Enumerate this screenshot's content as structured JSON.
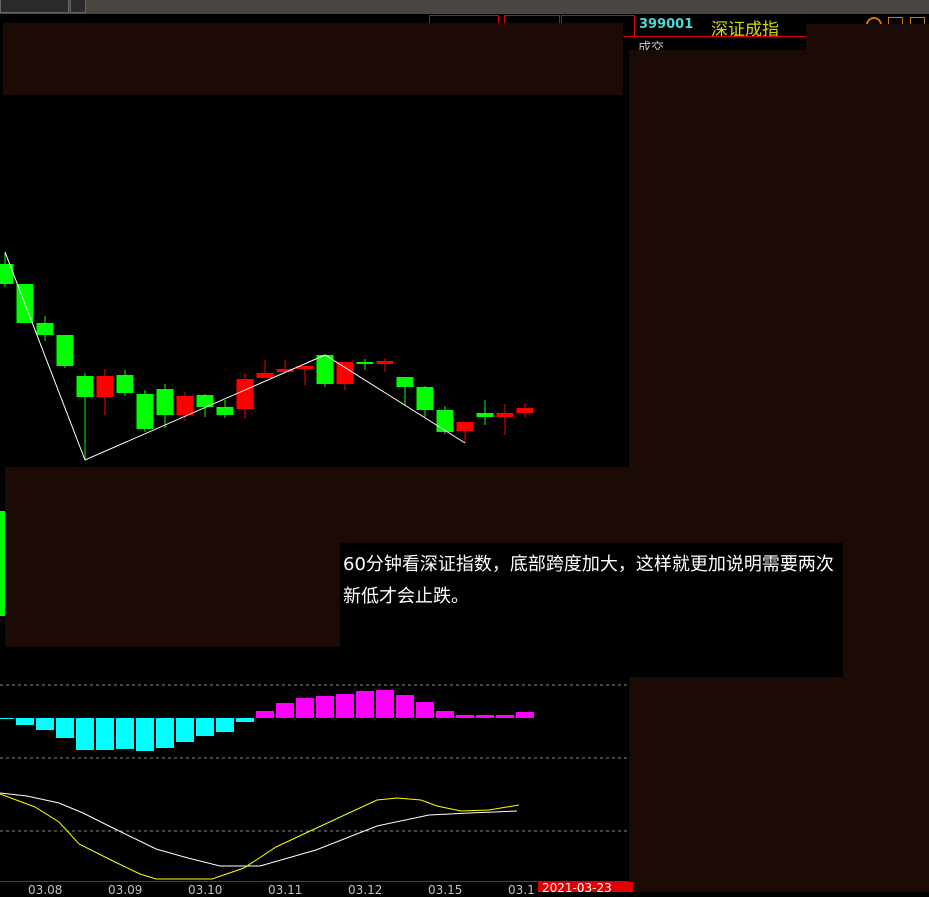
{
  "header": {
    "code": "399001",
    "name": "深证成指",
    "sub_label": "成交"
  },
  "axis": {
    "dates": [
      "03.08",
      "03.09",
      "03.10",
      "03.11",
      "03.12",
      "03.15",
      "03.1"
    ],
    "cursor_date": "2021-03-23"
  },
  "annotation": {
    "text": "60分钟看深证指数，底部跨度加大，这样就更加说明需要两次新低才会止跌。"
  },
  "colors": {
    "up": "#ff0000",
    "down": "#00ff00",
    "macd_pos": "#ff00ff",
    "macd_neg": "#00ffff",
    "dif": "#ffffff",
    "dea": "#ffff00",
    "overlay": "#1c0a06"
  },
  "chart_data": {
    "type": "candlestick",
    "candles": [
      {
        "o": 264,
        "c": 284,
        "h": 252,
        "l": 287
      },
      {
        "o": 284,
        "c": 323,
        "h": 284,
        "l": 323
      },
      {
        "o": 323,
        "c": 335,
        "h": 316,
        "l": 341
      },
      {
        "o": 335,
        "c": 366,
        "h": 335,
        "l": 368
      },
      {
        "o": 376,
        "c": 397,
        "h": 373,
        "l": 460
      },
      {
        "o": 397,
        "c": 376,
        "h": 369,
        "l": 415
      },
      {
        "o": 375,
        "c": 393,
        "h": 370,
        "l": 396
      },
      {
        "o": 394,
        "c": 429,
        "h": 390,
        "l": 432
      },
      {
        "o": 389,
        "c": 415,
        "h": 384,
        "l": 428
      },
      {
        "o": 415,
        "c": 396,
        "h": 392,
        "l": 421
      },
      {
        "o": 395,
        "c": 407,
        "h": 394,
        "l": 417
      },
      {
        "o": 407,
        "c": 415,
        "h": 400,
        "l": 418
      },
      {
        "o": 409,
        "c": 379,
        "h": 373,
        "l": 419
      },
      {
        "o": 378,
        "c": 373,
        "h": 360,
        "l": 378
      },
      {
        "o": 372,
        "c": 369,
        "h": 360,
        "l": 372
      },
      {
        "o": 369,
        "c": 366,
        "h": 366,
        "l": 385
      },
      {
        "o": 355,
        "c": 384,
        "h": 355,
        "l": 387
      },
      {
        "o": 384,
        "c": 362,
        "h": 362,
        "l": 390
      },
      {
        "o": 362,
        "c": 364,
        "h": 359,
        "l": 370
      },
      {
        "o": 364,
        "c": 361,
        "h": 358,
        "l": 372
      },
      {
        "o": 377,
        "c": 387,
        "h": 377,
        "l": 406
      },
      {
        "o": 387,
        "c": 410,
        "h": 386,
        "l": 417
      },
      {
        "o": 410,
        "c": 432,
        "h": 406,
        "l": 434
      },
      {
        "o": 431,
        "c": 422,
        "h": 422,
        "l": 443
      },
      {
        "o": 413,
        "c": 417,
        "h": 400,
        "l": 425
      },
      {
        "o": 417,
        "c": 413,
        "h": 404,
        "l": 435
      },
      {
        "o": 413,
        "c": 408,
        "h": 404,
        "l": 417
      }
    ],
    "price_scale_note": "values are inverted-scale readings (lower = higher price)",
    "zigzag": [
      [
        0,
        252
      ],
      [
        4,
        460
      ],
      [
        16,
        355
      ],
      [
        23,
        443
      ]
    ],
    "macd_hist": [
      -1,
      -7,
      -12,
      -20,
      -32,
      -32,
      -31,
      -33,
      -30,
      -24,
      -18,
      -14,
      -4,
      7,
      15,
      20,
      22,
      24,
      27,
      28,
      23,
      16,
      7,
      3,
      3,
      3,
      6
    ],
    "dif": [
      [
        0,
        793
      ],
      [
        1.35,
        796
      ],
      [
        2.95,
        803
      ],
      [
        4.15,
        813
      ],
      [
        5.75,
        829
      ],
      [
        7.8,
        849
      ],
      [
        9.4,
        858
      ],
      [
        11,
        866
      ],
      [
        13,
        866
      ],
      [
        15.8,
        850
      ],
      [
        18.85,
        826
      ],
      [
        21.45,
        815
      ],
      [
        23.45,
        813
      ],
      [
        25.85,
        811
      ]
    ],
    "dea": [
      [
        0,
        794
      ],
      [
        1.75,
        807
      ],
      [
        2.95,
        822
      ],
      [
        3.95,
        844
      ],
      [
        5.75,
        862
      ],
      [
        7,
        874
      ],
      [
        7.8,
        879
      ],
      [
        10.6,
        879
      ],
      [
        12.2,
        868
      ],
      [
        13.8,
        847
      ],
      [
        15.4,
        832
      ],
      [
        18.85,
        800
      ],
      [
        19.85,
        798
      ],
      [
        21.05,
        800
      ],
      [
        21.85,
        806
      ],
      [
        23.05,
        811
      ],
      [
        24.45,
        810
      ],
      [
        25.95,
        805
      ]
    ]
  }
}
